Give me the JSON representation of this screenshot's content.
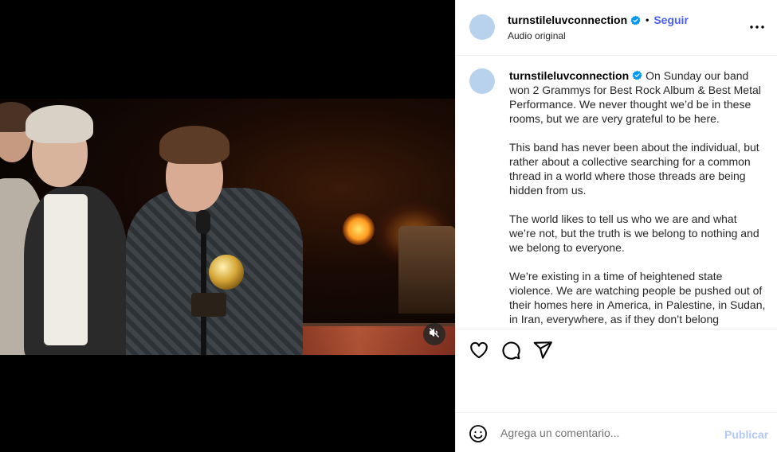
{
  "post": {
    "username": "turnstileluvconnection",
    "follow_label": "Seguir",
    "dot": "•",
    "audio_label": "Audio original"
  },
  "caption": {
    "username": "turnstileluvconnection",
    "paragraphs": [
      "On Sunday our band won 2 Grammys for Best Rock Album & Best Metal Performance. We never thought we’d be in these rooms, but we are very grateful to be here.",
      "This band has never been about the individual, but rather about a collective searching for a common thread in a world where those threads are being hidden from us.",
      "The world likes to tell us who we are and what we’re not, but the truth is we belong to nothing and we belong to everyone.",
      "We’re existing in a time of heightened state violence. We are watching people be pushed out of their homes here in America, in Palestine, in Sudan, in Iran, everywhere, as if they don’t belong"
    ]
  },
  "comment": {
    "placeholder": "Agrega un comentario...",
    "publish_label": "Publicar"
  },
  "icons": {
    "verified": "verified-badge-icon",
    "more": "more-options-icon",
    "like": "heart-icon",
    "comment": "comment-icon",
    "share": "share-icon",
    "emoji": "emoji-icon",
    "mute": "muted-speaker-icon"
  },
  "colors": {
    "accent": "#4a5df9",
    "verified": "#0095f6",
    "publish_disabled": "#b3c8f5",
    "avatar": "#b8d2ee"
  }
}
